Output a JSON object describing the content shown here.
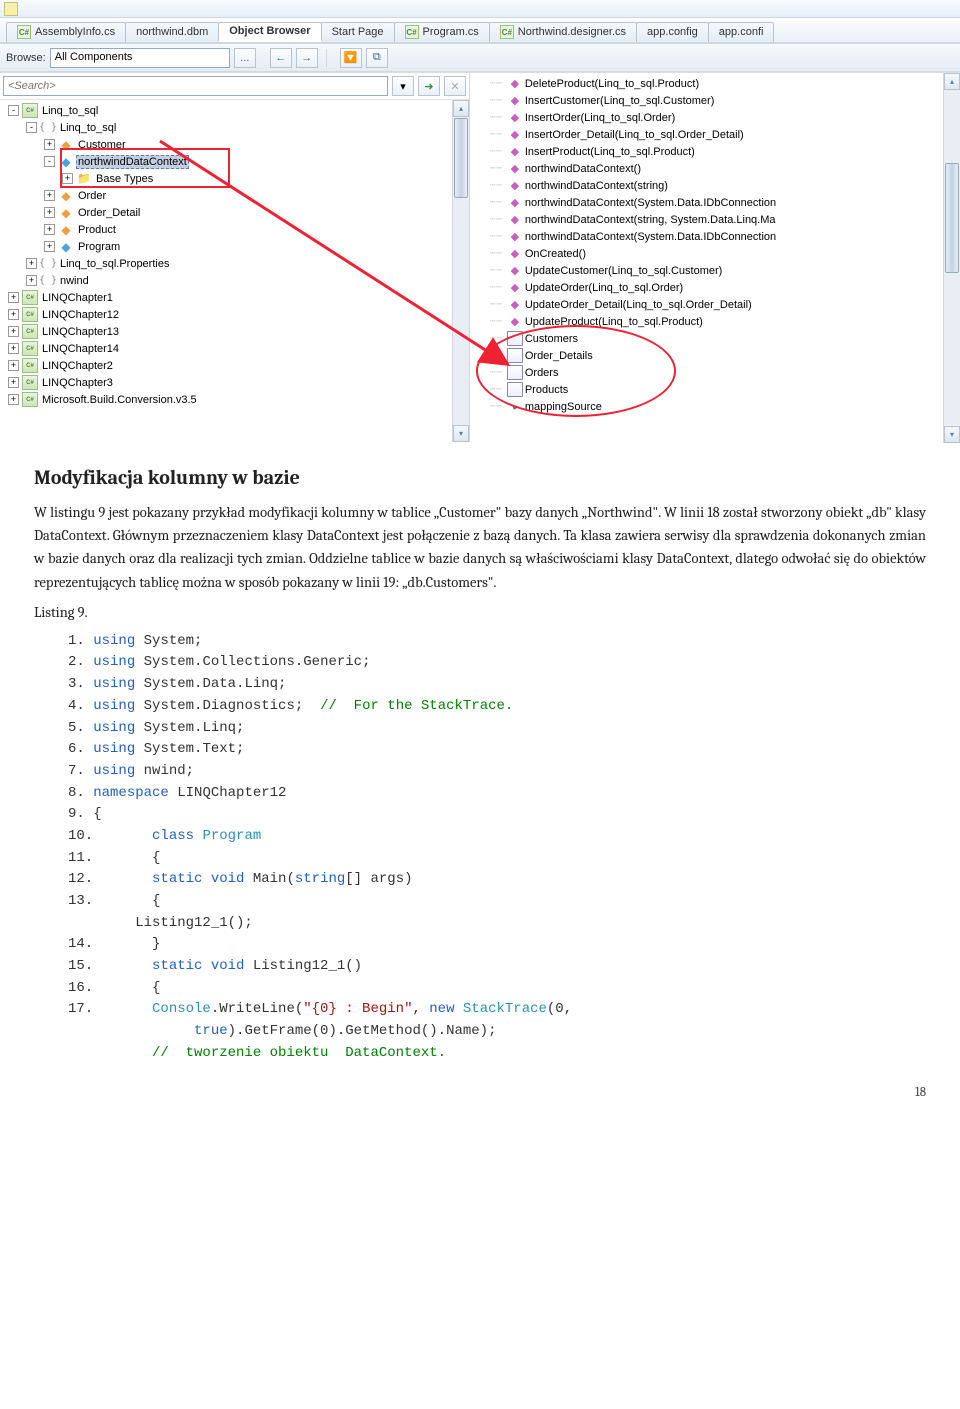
{
  "tabs": [
    {
      "label": "AssemblyInfo.cs",
      "active": false,
      "kind": "cs"
    },
    {
      "label": "northwind.dbm",
      "active": false,
      "kind": "plain"
    },
    {
      "label": "Object Browser",
      "active": true,
      "kind": "plain"
    },
    {
      "label": "Start Page",
      "active": false,
      "kind": "plain"
    },
    {
      "label": "Program.cs",
      "active": false,
      "kind": "cs"
    },
    {
      "label": "Northwind.designer.cs",
      "active": false,
      "kind": "cs"
    },
    {
      "label": "app.config",
      "active": false,
      "kind": "plain"
    },
    {
      "label": "app.confi",
      "active": false,
      "kind": "plain"
    }
  ],
  "browse": {
    "label": "Browse:",
    "selected": "All Components",
    "btn_ellipsis": "...",
    "btn_back": "←",
    "btn_fwd": "→"
  },
  "search": {
    "placeholder": "<Search>",
    "dropdown_char": "▾"
  },
  "left_tree": [
    {
      "indent": 0,
      "exp": "-",
      "ico": "asm",
      "label": "Linq_to_sql"
    },
    {
      "indent": 1,
      "exp": "-",
      "ico": "ns",
      "label": "Linq_to_sql"
    },
    {
      "indent": 2,
      "exp": "+",
      "ico": "cls2",
      "label": "Customer"
    },
    {
      "indent": 2,
      "exp": "-",
      "ico": "cls",
      "label": "northwindDataContext",
      "selected": true
    },
    {
      "indent": 3,
      "exp": "+",
      "ico": "folder",
      "label": "Base Types"
    },
    {
      "indent": 2,
      "exp": "+",
      "ico": "cls2",
      "label": "Order"
    },
    {
      "indent": 2,
      "exp": "+",
      "ico": "cls2",
      "label": "Order_Detail"
    },
    {
      "indent": 2,
      "exp": "+",
      "ico": "cls2",
      "label": "Product"
    },
    {
      "indent": 2,
      "exp": "+",
      "ico": "cls",
      "label": "Program"
    },
    {
      "indent": 1,
      "exp": "+",
      "ico": "ns",
      "label": "Linq_to_sql.Properties"
    },
    {
      "indent": 1,
      "exp": "+",
      "ico": "ns",
      "label": "nwind"
    },
    {
      "indent": 0,
      "exp": "+",
      "ico": "asm",
      "label": "LINQChapter1"
    },
    {
      "indent": 0,
      "exp": "+",
      "ico": "asm",
      "label": "LINQChapter12"
    },
    {
      "indent": 0,
      "exp": "+",
      "ico": "asm",
      "label": "LINQChapter13"
    },
    {
      "indent": 0,
      "exp": "+",
      "ico": "asm",
      "label": "LINQChapter14"
    },
    {
      "indent": 0,
      "exp": "+",
      "ico": "asm",
      "label": "LINQChapter2"
    },
    {
      "indent": 0,
      "exp": "+",
      "ico": "asm",
      "label": "LINQChapter3"
    },
    {
      "indent": 0,
      "exp": "+",
      "ico": "asm",
      "label": "Microsoft.Build.Conversion.v3.5"
    }
  ],
  "right_list": [
    {
      "ico": "method",
      "label": "DeleteProduct(Linq_to_sql.Product)"
    },
    {
      "ico": "method",
      "label": "InsertCustomer(Linq_to_sql.Customer)"
    },
    {
      "ico": "method",
      "label": "InsertOrder(Linq_to_sql.Order)"
    },
    {
      "ico": "method",
      "label": "InsertOrder_Detail(Linq_to_sql.Order_Detail)"
    },
    {
      "ico": "method",
      "label": "InsertProduct(Linq_to_sql.Product)"
    },
    {
      "ico": "method",
      "label": "northwindDataContext()"
    },
    {
      "ico": "method",
      "label": "northwindDataContext(string)"
    },
    {
      "ico": "method",
      "label": "northwindDataContext(System.Data.IDbConnection"
    },
    {
      "ico": "method",
      "label": "northwindDataContext(string, System.Data.Linq.Ma"
    },
    {
      "ico": "method",
      "label": "northwindDataContext(System.Data.IDbConnection"
    },
    {
      "ico": "method",
      "label": "OnCreated()"
    },
    {
      "ico": "method",
      "label": "UpdateCustomer(Linq_to_sql.Customer)"
    },
    {
      "ico": "method",
      "label": "UpdateOrder(Linq_to_sql.Order)"
    },
    {
      "ico": "method",
      "label": "UpdateOrder_Detail(Linq_to_sql.Order_Detail)"
    },
    {
      "ico": "method",
      "label": "UpdateProduct(Linq_to_sql.Product)"
    },
    {
      "ico": "tbl",
      "label": "Customers"
    },
    {
      "ico": "tbl",
      "label": "Order_Details"
    },
    {
      "ico": "tbl",
      "label": "Orders"
    },
    {
      "ico": "tbl",
      "label": "Products"
    },
    {
      "ico": "field",
      "label": "mappingSource"
    }
  ],
  "doc": {
    "heading": "Modyfikacja kolumny w bazie",
    "para1": "W listingu 9 jest pokazany przykład modyfikacji kolumny w tablice „Customer\" bazy danych „Northwind\". W linii 18 został stworzony obiekt „db\" klasy DataContext. Głównym przeznaczeniem klasy DataContext jest połączenie z bazą danych. Ta klasa zawiera serwisy dla sprawdzenia dokonanych zmian w bazie danych oraz dla realizacji tych zmian. Oddzielne tablice w bazie danych są właściwościami klasy DataContext, dlatego odwołać się do obiektów reprezentujących tablicę można w sposób pokazany w linii 19: „db.Customers\".",
    "listing_lbl": "Listing 9.",
    "code_lines": {
      "l1a": "1. ",
      "l1b": "using",
      "l1c": " System;",
      "l2a": "2. ",
      "l2b": "using",
      "l2c": " System.Collections.Generic;",
      "l3a": "3. ",
      "l3b": "using",
      "l3c": " System.Data.Linq;",
      "l4a": "4. ",
      "l4b": "using",
      "l4c": " System.Diagnostics;  ",
      "l4d": "//  For the StackTrace.",
      "l5a": "5. ",
      "l5b": "using",
      "l5c": " System.Linq;",
      "l6a": "6. ",
      "l6b": "using",
      "l6c": " System.Text;",
      "l7a": "7. ",
      "l7b": "using",
      "l7c": " nwind;",
      "l8a": "8. ",
      "l8b": "namespace",
      "l8c": " LINQChapter12",
      "l9": "9. {",
      "l10a": "10.       ",
      "l10b": "class ",
      "l10c": "Program",
      "l11": "11.       {",
      "l12a": "12.       ",
      "l12b": "static void",
      "l12c": " Main(",
      "l12d": "string",
      "l12e": "[] args)",
      "l13": "13.       {",
      "l13b": "        Listing12_1();",
      "l14": "14.       }",
      "blank": "",
      "l15a": "15.       ",
      "l15b": "static void",
      "l15c": " Listing12_1()",
      "l16": "16.       {",
      "l17a": "17.       ",
      "l17b": "Console",
      "l17c": ".WriteLine(",
      "l17d": "\"{0} : Begin\"",
      "l17e": ", ",
      "l17f": "new ",
      "l17g": "StackTrace",
      "l17h": "(0,",
      "l17ia": "               ",
      "l17ib": "true",
      "l17ic": ").GetFrame(0).GetMethod().Name);",
      "l17ja": "          ",
      "l17jb": "//  tworzenie obiektu  DataContext."
    },
    "page_number": "18"
  }
}
